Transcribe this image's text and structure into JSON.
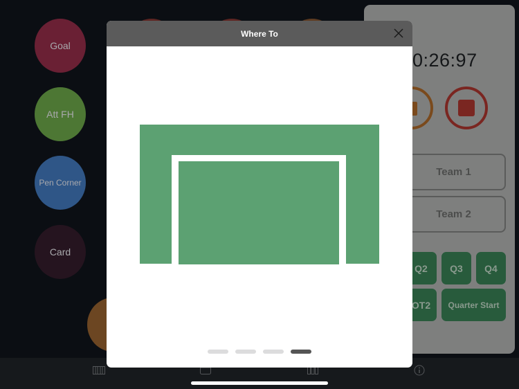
{
  "background": {
    "action_buttons": [
      {
        "label": "Goal",
        "color": "#6a2034"
      },
      {
        "label": "Att FH",
        "color": "#4d7734"
      },
      {
        "label": "Pen Corner",
        "color": "#2f5687"
      },
      {
        "label": "Card",
        "color": "#25141f"
      }
    ]
  },
  "timer_panel": {
    "time": "0:26:97",
    "pause_icon": "pause-icon",
    "stop_icon": "stop-icon",
    "teams": [
      "Team 1",
      "Team 2"
    ],
    "quarter_buttons": [
      "Q2",
      "Q3",
      "Q4",
      "OT2",
      "Quarter Start"
    ],
    "colors": {
      "quarter_button": "#3c8a5a",
      "pause": "#c47a2e",
      "stop": "#c23a33"
    }
  },
  "tabbar": {
    "icons": [
      "field-icon",
      "calendar-icon",
      "stats-icon",
      "info-icon"
    ]
  },
  "modal": {
    "title": "Where To",
    "close_icon": "close-icon",
    "field_color": "#5ca172",
    "pager": {
      "total": 4,
      "active": 4
    }
  }
}
